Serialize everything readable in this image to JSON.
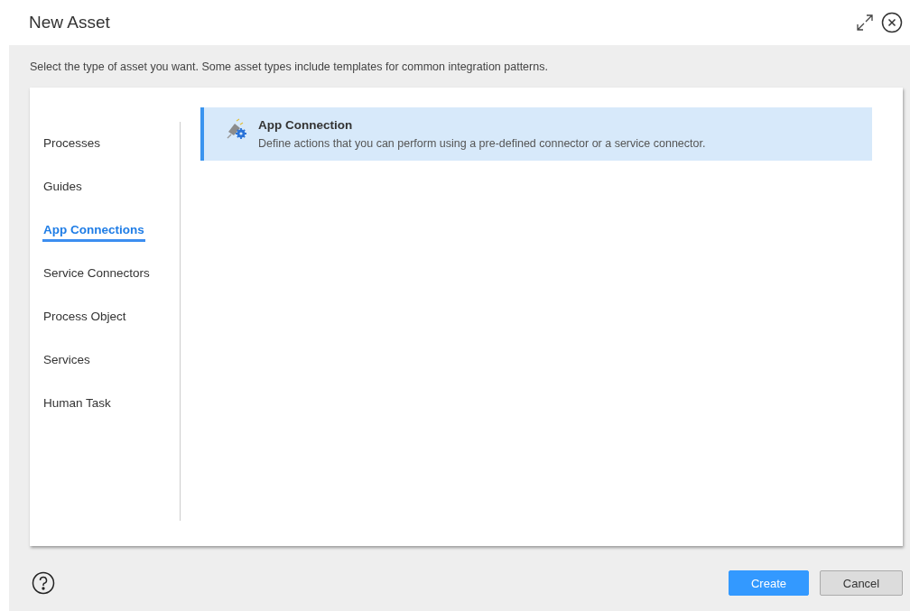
{
  "dialog": {
    "title": "New Asset"
  },
  "instructions": "Select the type of asset you want. Some asset types include templates for common integration patterns.",
  "categories": [
    {
      "label": "Processes",
      "selected": false
    },
    {
      "label": "Guides",
      "selected": false
    },
    {
      "label": "App Connections",
      "selected": true
    },
    {
      "label": "Service Connectors",
      "selected": false
    },
    {
      "label": "Process Object",
      "selected": false
    },
    {
      "label": "Services",
      "selected": false
    },
    {
      "label": "Human Task",
      "selected": false
    }
  ],
  "asset_types": [
    {
      "title": "App Connection",
      "description": "Define actions that you can perform using a pre-defined connector or a service connector.",
      "selected": true
    }
  ],
  "buttons": [
    {
      "label": "Create",
      "kind": "primary"
    },
    {
      "label": "Cancel",
      "kind": "secondary"
    }
  ]
}
